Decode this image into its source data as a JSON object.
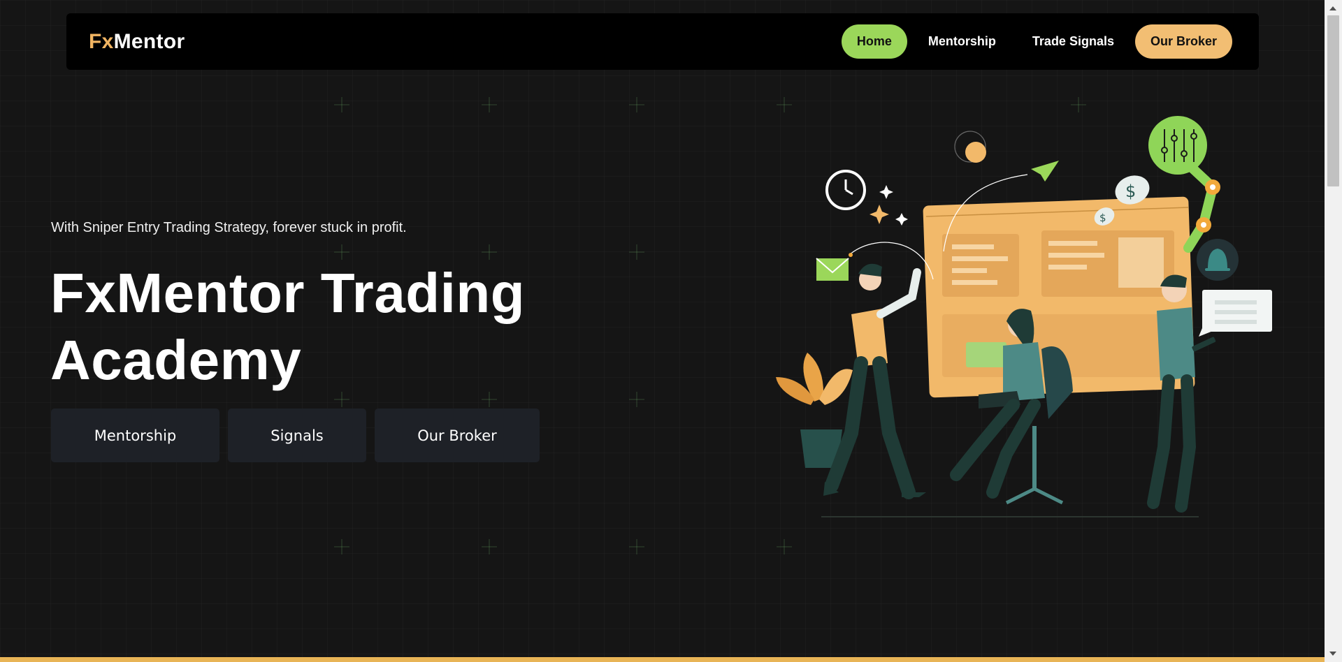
{
  "brand": {
    "prefix": "Fx",
    "suffix": "Mentor"
  },
  "nav": {
    "items": [
      {
        "label": "Home"
      },
      {
        "label": "Mentorship"
      },
      {
        "label": "Trade Signals"
      },
      {
        "label": "Our Broker"
      }
    ]
  },
  "hero": {
    "tagline": "With Sniper Entry Trading Strategy, forever stuck in profit.",
    "title": "FxMentor Trading Academy",
    "buttons": [
      {
        "label": "Mentorship"
      },
      {
        "label": "Signals"
      },
      {
        "label": "Our Broker"
      }
    ]
  },
  "colors": {
    "accent_green": "#9bd75a",
    "accent_orange": "#f2be73",
    "background": "#151515",
    "navbar": "#000000",
    "bottom_strip": "#e8b456"
  },
  "icons": [
    "clock-icon",
    "paper-plane-icon",
    "mail-icon",
    "dollar-coin-icon",
    "sliders-icon",
    "bell-icon",
    "chat-bubble-icon",
    "sparkle-icon"
  ]
}
